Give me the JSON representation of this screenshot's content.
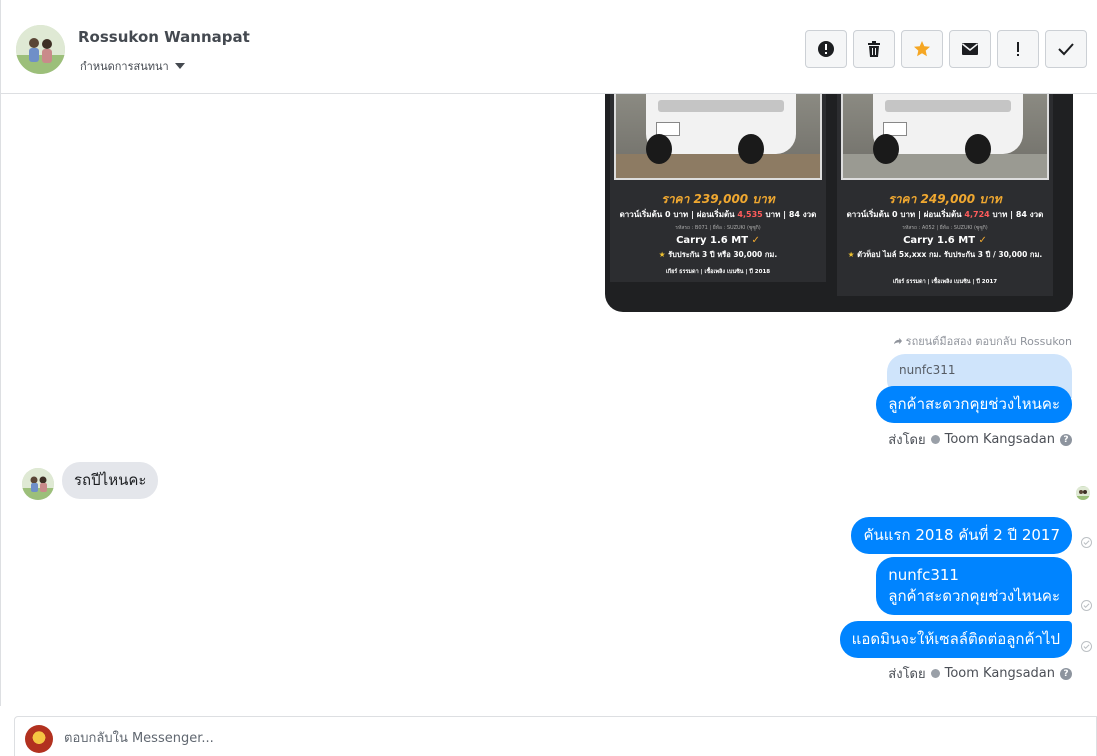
{
  "contact": {
    "name": "Rossukon Wannapat",
    "subtitle": "กำหนดการสนทนา"
  },
  "actions": [
    {
      "name": "spam-button",
      "icon": "alert-icon"
    },
    {
      "name": "delete-button",
      "icon": "trash-icon"
    },
    {
      "name": "star-button",
      "icon": "star-icon",
      "color": "#f5a623"
    },
    {
      "name": "mark-unread-button",
      "icon": "envelope-icon"
    },
    {
      "name": "important-button",
      "icon": "exclamation-icon"
    },
    {
      "name": "done-button",
      "icon": "check-icon"
    }
  ],
  "car_card": {
    "left": {
      "price": "ราคา 239,000 บาท",
      "terms_a": "ดาวน์เริ่มต้น 0 บาท | ผ่อนเริ่มต้น ",
      "installment": "4,535",
      "terms_b": " บาท | 84 งวด",
      "meta": "รหัสรถ : B071 | ยี่ห้อ : SUZUKI (ซูซูกิ)",
      "model": "Carry 1.6 MT",
      "warranty": "รับประกัน 3 ปี หรือ 30,000 กม.",
      "footer": "เกียร์ ธรรมดา | เชื้อเพลิง เบนซิน | ปี 2018"
    },
    "right": {
      "price": "ราคา 249,000 บาท",
      "terms_a": "ดาวน์เริ่มต้น 0 บาท | ผ่อนเริ่มต้น ",
      "installment": "4,724",
      "terms_b": " บาท | 84 งวด",
      "meta": "รหัสรถ : A052 | ยี่ห้อ : SUZUKI (ซูซูกิ)",
      "model": "Carry 1.6 MT",
      "warranty": "ตัวท็อป ไมล์ 5x,xxx กม. รับประกัน 3 ปี / 30,000 กม.",
      "footer": "เกียร์ ธรรมดา | เชื้อเพลิง เบนซิน | ปี 2017"
    }
  },
  "messages": {
    "reply_meta": "รถยนต์มือสอง ตอบกลับ Rossukon",
    "quoted_text": "nunfc311",
    "out_1": "ลูกค้าสะดวกคุยช่วงไหนคะ",
    "sent_by_1": "ส่งโดย",
    "sender_1": "Toom Kangsadan",
    "in_1": "รถปีไหนคะ",
    "out_2": "คันแรก 2018 คันที่ 2 ปี 2017",
    "out_3_line1": "nunfc311",
    "out_3_line2": "ลูกค้าสะดวกคุยช่วงไหนคะ",
    "out_4": "แอดมินจะให้เซลล์ติดต่อลูกค้าไป",
    "sent_by_2": "ส่งโดย",
    "sender_2": "Toom Kangsadan"
  },
  "composer": {
    "placeholder": "ตอบกลับใน Messenger..."
  },
  "colors": {
    "bubble_out": "#0084ff",
    "bubble_in": "#e4e6eb",
    "quote_bg": "#cfe4fb"
  }
}
